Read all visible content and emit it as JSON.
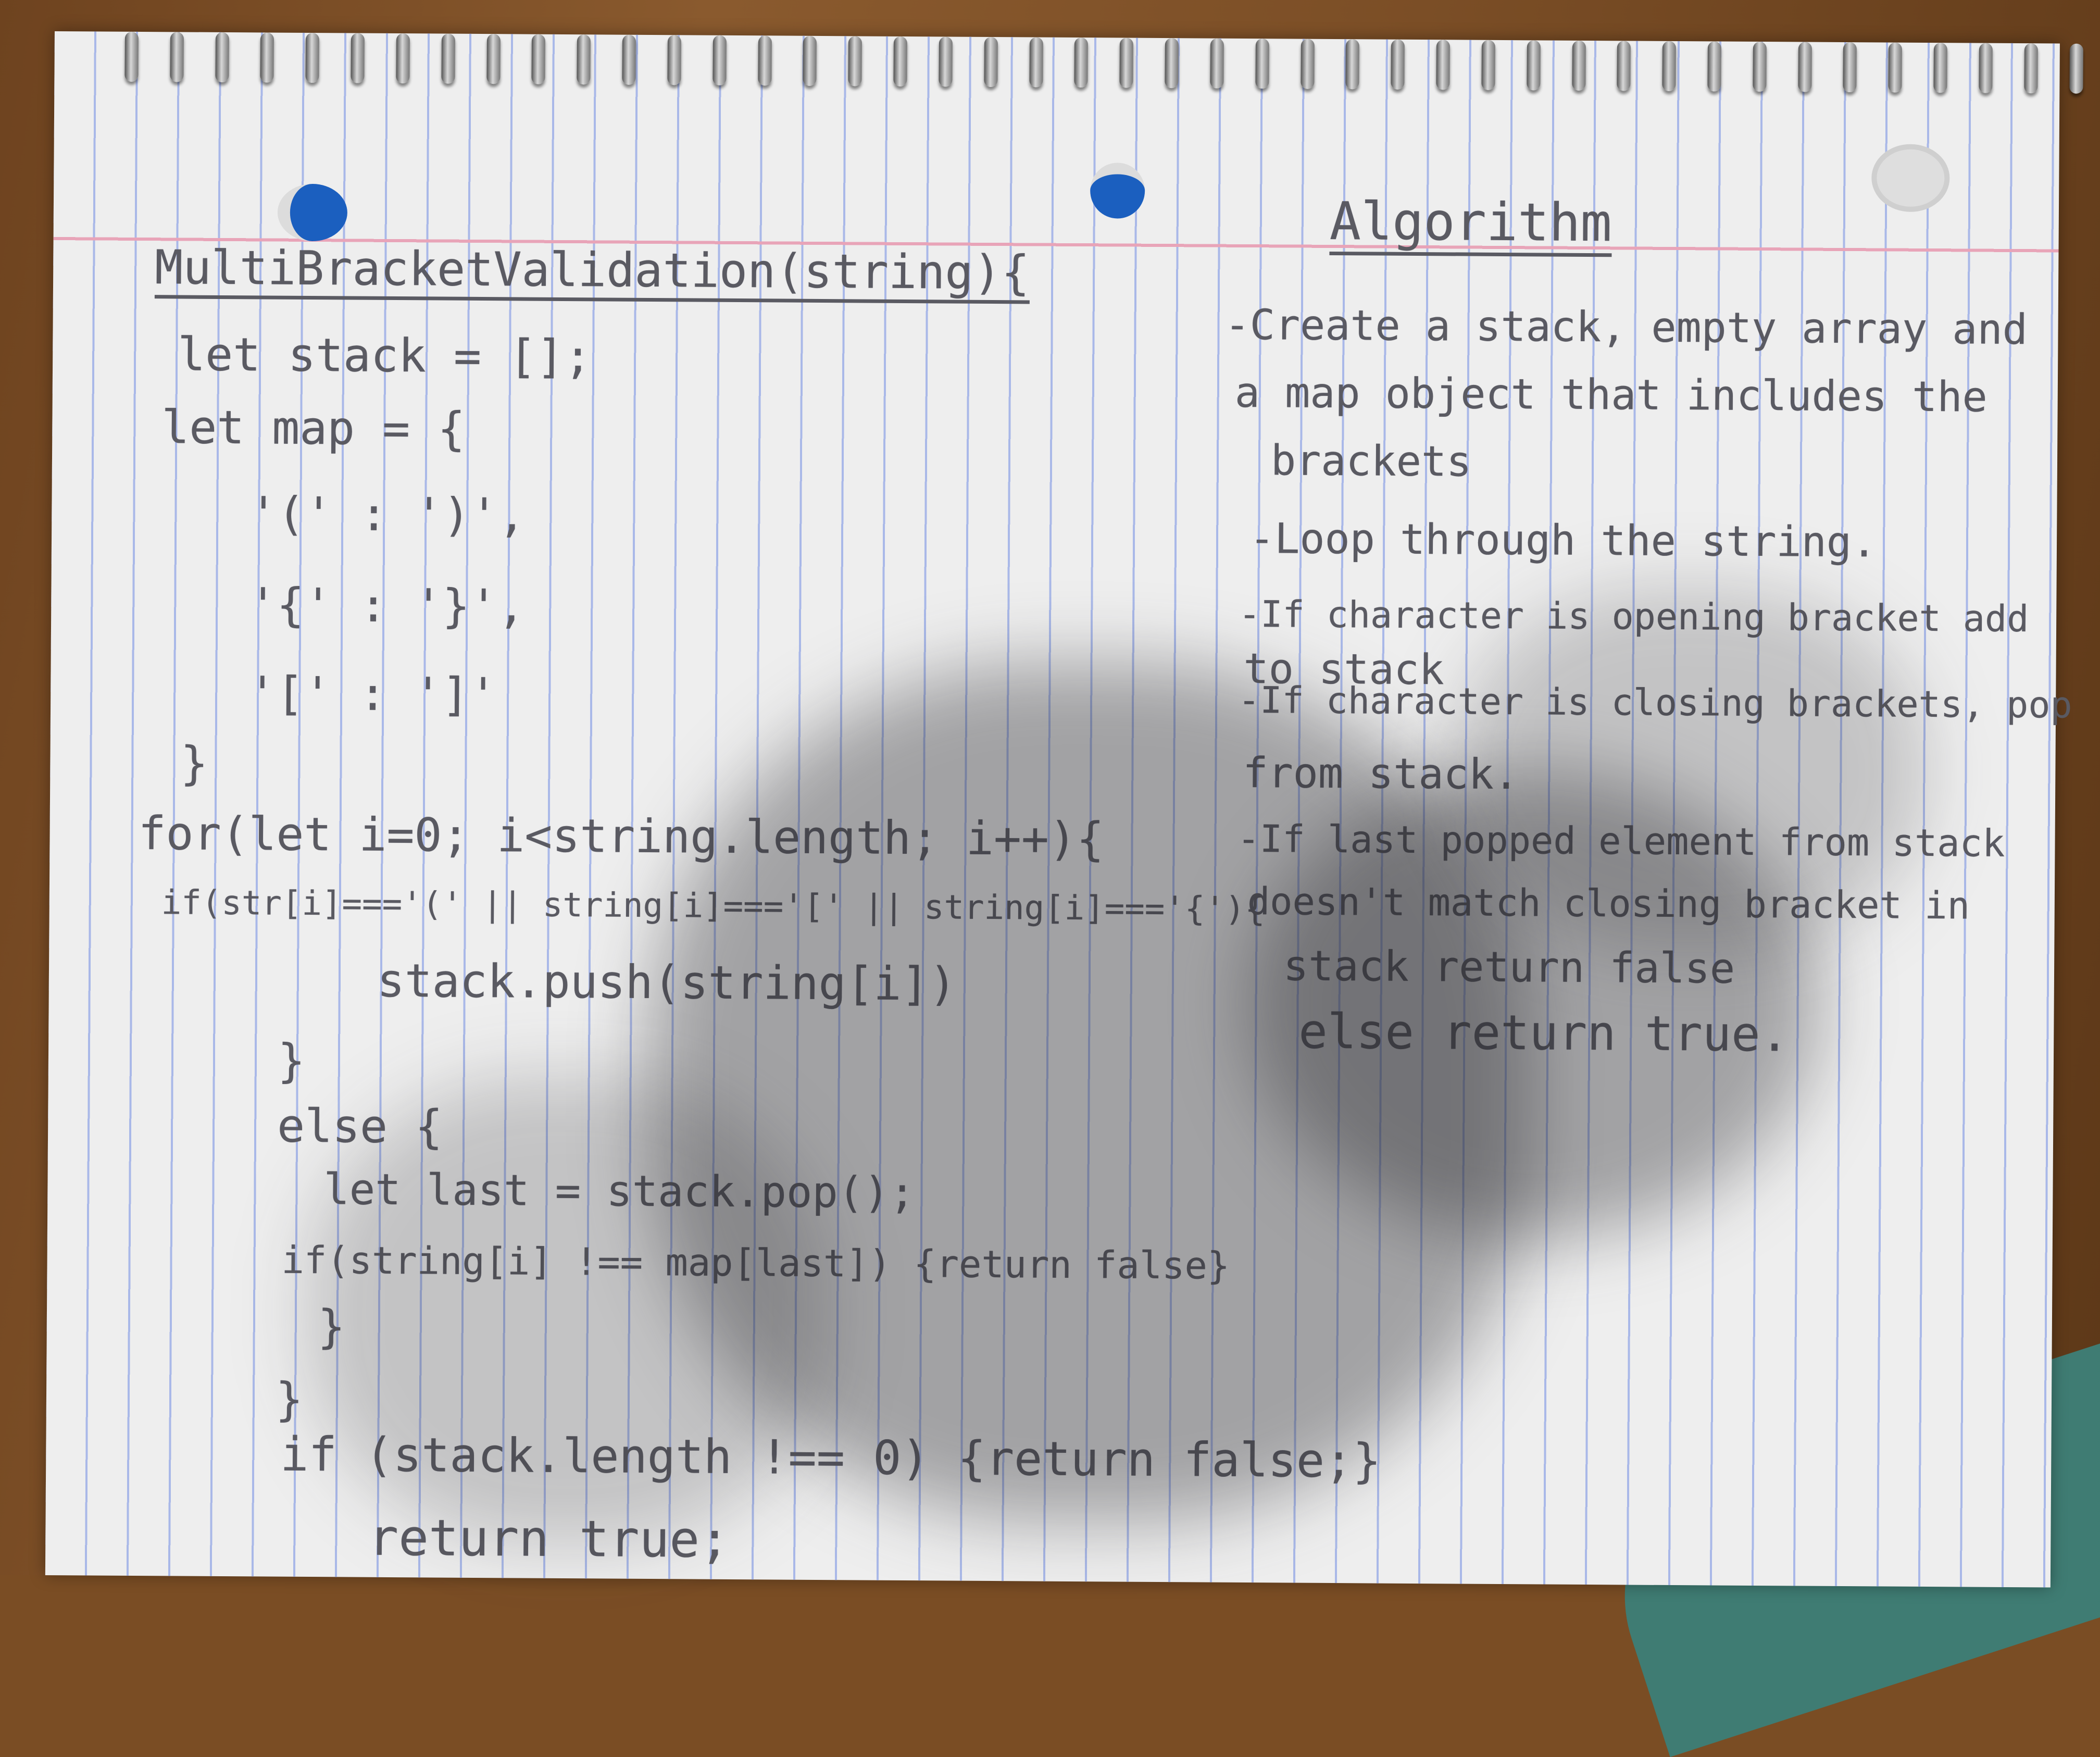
{
  "code": {
    "title": "MultiBracketValidation(string){",
    "lines": [
      "let stack = [];",
      "let map = {",
      "'(' : ')',",
      "'{' : '}',",
      "'[' : ']'",
      "}",
      "for(let i=0; i<string.length; i++){",
      "if(str[i]==='(' || string[i]==='[' || string[i]==='{'){",
      "stack.push(string[i])",
      "}",
      "else {",
      "let last = stack.pop();",
      "if(string[i] !== map[last]) {return false}",
      "}",
      "}",
      "if (stack.length !== 0) {return false;}",
      "return true;"
    ]
  },
  "algorithm": {
    "title": "Algorithm",
    "lines": [
      "-Create a stack, empty array and",
      "a map object that includes the",
      "brackets",
      "-Loop through the string.",
      "-If character is opening bracket add",
      "to stack",
      "-If character is closing brackets, pop",
      "from stack.",
      "-If last popped element from stack",
      "doesn't match closing bracket in",
      "stack return false",
      "else return true."
    ]
  },
  "colors": {
    "paper": "#eeeeee",
    "pencil": "#5a5a62",
    "rule_lines": "#a9b8e8",
    "margin_line": "#e8a4b8",
    "table": "#7a4d24"
  }
}
